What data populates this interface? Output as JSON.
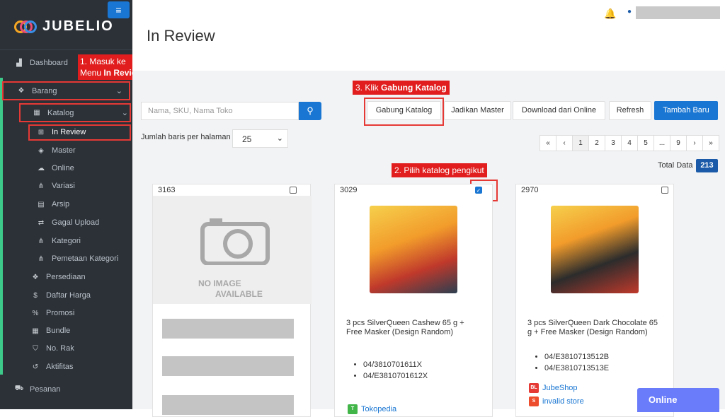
{
  "app": {
    "logo_text": "JUBELIO",
    "page_title": "In Review"
  },
  "sidebar": {
    "dashboard": "Dashboard",
    "barang": "Barang",
    "katalog": "Katalog",
    "sub": [
      {
        "label": "In Review",
        "icon": "plus-square-icon"
      },
      {
        "label": "Master",
        "icon": "cube-icon"
      },
      {
        "label": "Online",
        "icon": "cloud-icon"
      },
      {
        "label": "Variasi",
        "icon": "sitemap-icon"
      },
      {
        "label": "Arsip",
        "icon": "archive-icon"
      },
      {
        "label": "Gagal Upload",
        "icon": "retweet-icon"
      },
      {
        "label": "Kategori",
        "icon": "sitemap-icon"
      },
      {
        "label": "Pemetaan Kategori",
        "icon": "sitemap-icon"
      }
    ],
    "items": [
      {
        "label": "Persediaan",
        "icon": "cubes-icon"
      },
      {
        "label": "Daftar Harga",
        "icon": "dollar-icon"
      },
      {
        "label": "Promosi",
        "icon": "percent-icon"
      },
      {
        "label": "Bundle",
        "icon": "th-large-icon"
      },
      {
        "label": "No. Rak",
        "icon": "bookmark-icon"
      },
      {
        "label": "Aktifitas",
        "icon": "history-icon"
      }
    ],
    "pesanan": "Pesanan"
  },
  "annotations": {
    "step1_line1": "1. Masuk ke",
    "step1_line2_prefix": "Menu ",
    "step1_line2_bold": "In Review",
    "step2": "2. Pilih katalog pengikut",
    "step3_prefix": "3. Klik ",
    "step3_bold": "Gabung Katalog"
  },
  "toolbar": {
    "search_placeholder": "Nama, SKU, Nama Toko",
    "btn_gabung": "Gabung Katalog",
    "btn_jadikan": "Jadikan Master",
    "btn_download": "Download dari Online",
    "btn_refresh": "Refresh",
    "btn_tambah": "Tambah Baru"
  },
  "rows": {
    "label": "Jumlah baris per halaman",
    "value": "25"
  },
  "pagination": [
    "«",
    "‹",
    "1",
    "2",
    "3",
    "4",
    "5",
    "...",
    "9",
    "›",
    "»"
  ],
  "total": {
    "label": "Total Data",
    "value": "213"
  },
  "cards": [
    {
      "id": "3163",
      "checked": false,
      "no_image_1": "NO IMAGE",
      "no_image_2": "AVAILABLE"
    },
    {
      "id": "3029",
      "checked": true,
      "name": "3 pcs SilverQueen Cashew 65 g + Free Masker (Design Random)",
      "skus": [
        "04/3810701611X",
        "04/E3810701612X"
      ],
      "store": "Tokopedia"
    },
    {
      "id": "2970",
      "checked": false,
      "name": "3 pcs SilverQueen Dark Chocolate 65 g + Free Masker (Design Random)",
      "skus": [
        "04/E3810713512B",
        "04/E3810713513E"
      ],
      "stores": [
        "JubeShop",
        "invalid store"
      ]
    }
  ],
  "online_widget": "Online",
  "colors": {
    "sidebar": "#2c3138",
    "accent": "#1976d2",
    "annotation_red": "#e11d1d",
    "active_green": "#3cc98a",
    "online_widget": "#6b7cfa"
  }
}
